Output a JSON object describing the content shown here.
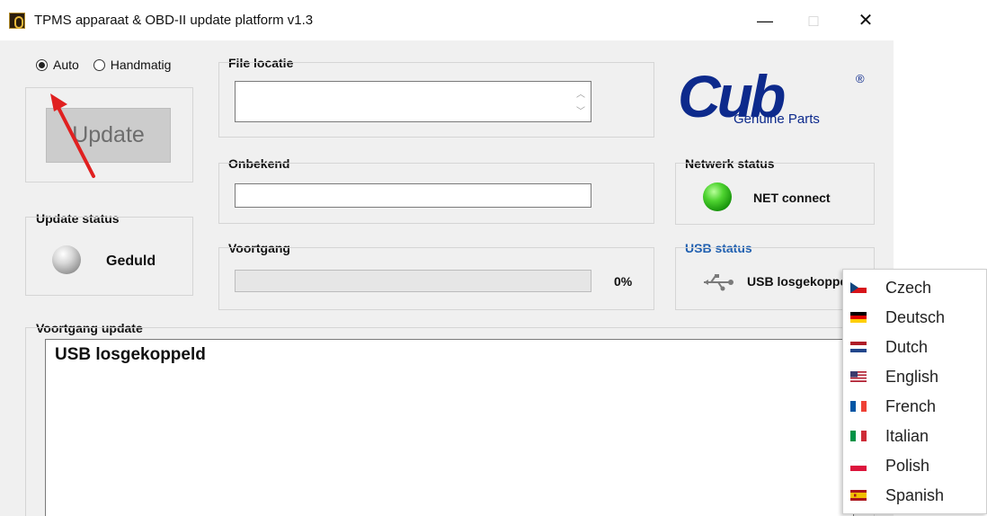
{
  "window": {
    "title": "TPMS apparaat & OBD-II update platform v1.3",
    "controls": {
      "minimize": "—",
      "maximize": "□",
      "close": "✕"
    }
  },
  "mode": {
    "auto_label": "Auto",
    "manual_label": "Handmatig",
    "selected": "Auto"
  },
  "update_button": {
    "label": "Update",
    "enabled": false
  },
  "update_status": {
    "heading": "Update status",
    "text": "Geduld",
    "indicator": "grey"
  },
  "file_location": {
    "heading": "File locatie",
    "value": ""
  },
  "unknown": {
    "heading": "Onbekend",
    "value": ""
  },
  "progress": {
    "heading": "Voortgang",
    "value": 0,
    "percent_text": "0%"
  },
  "logo": {
    "brand": "Cub",
    "tagline": "Genuine Parts",
    "registered": "®",
    "color": "#0d2a8c"
  },
  "network_status": {
    "heading": "Netwerk status",
    "text": "NET connect",
    "indicator": "green"
  },
  "usb_status": {
    "heading": "USB status",
    "text": "USB losgekoppeld",
    "icon": "usb-icon",
    "heading_color": "#1f5fb0"
  },
  "progress_log": {
    "heading": "Voortgang update",
    "text": "USB losgekoppeld"
  },
  "language_menu": {
    "items": [
      {
        "label": "Czech",
        "flag": "cz"
      },
      {
        "label": "Deutsch",
        "flag": "de"
      },
      {
        "label": "Dutch",
        "flag": "nl"
      },
      {
        "label": "English",
        "flag": "us"
      },
      {
        "label": "French",
        "flag": "fr"
      },
      {
        "label": "Italian",
        "flag": "it"
      },
      {
        "label": "Polish",
        "flag": "pl"
      },
      {
        "label": "Spanish",
        "flag": "es"
      }
    ]
  },
  "annotation": {
    "arrow_color": "#e02020"
  }
}
